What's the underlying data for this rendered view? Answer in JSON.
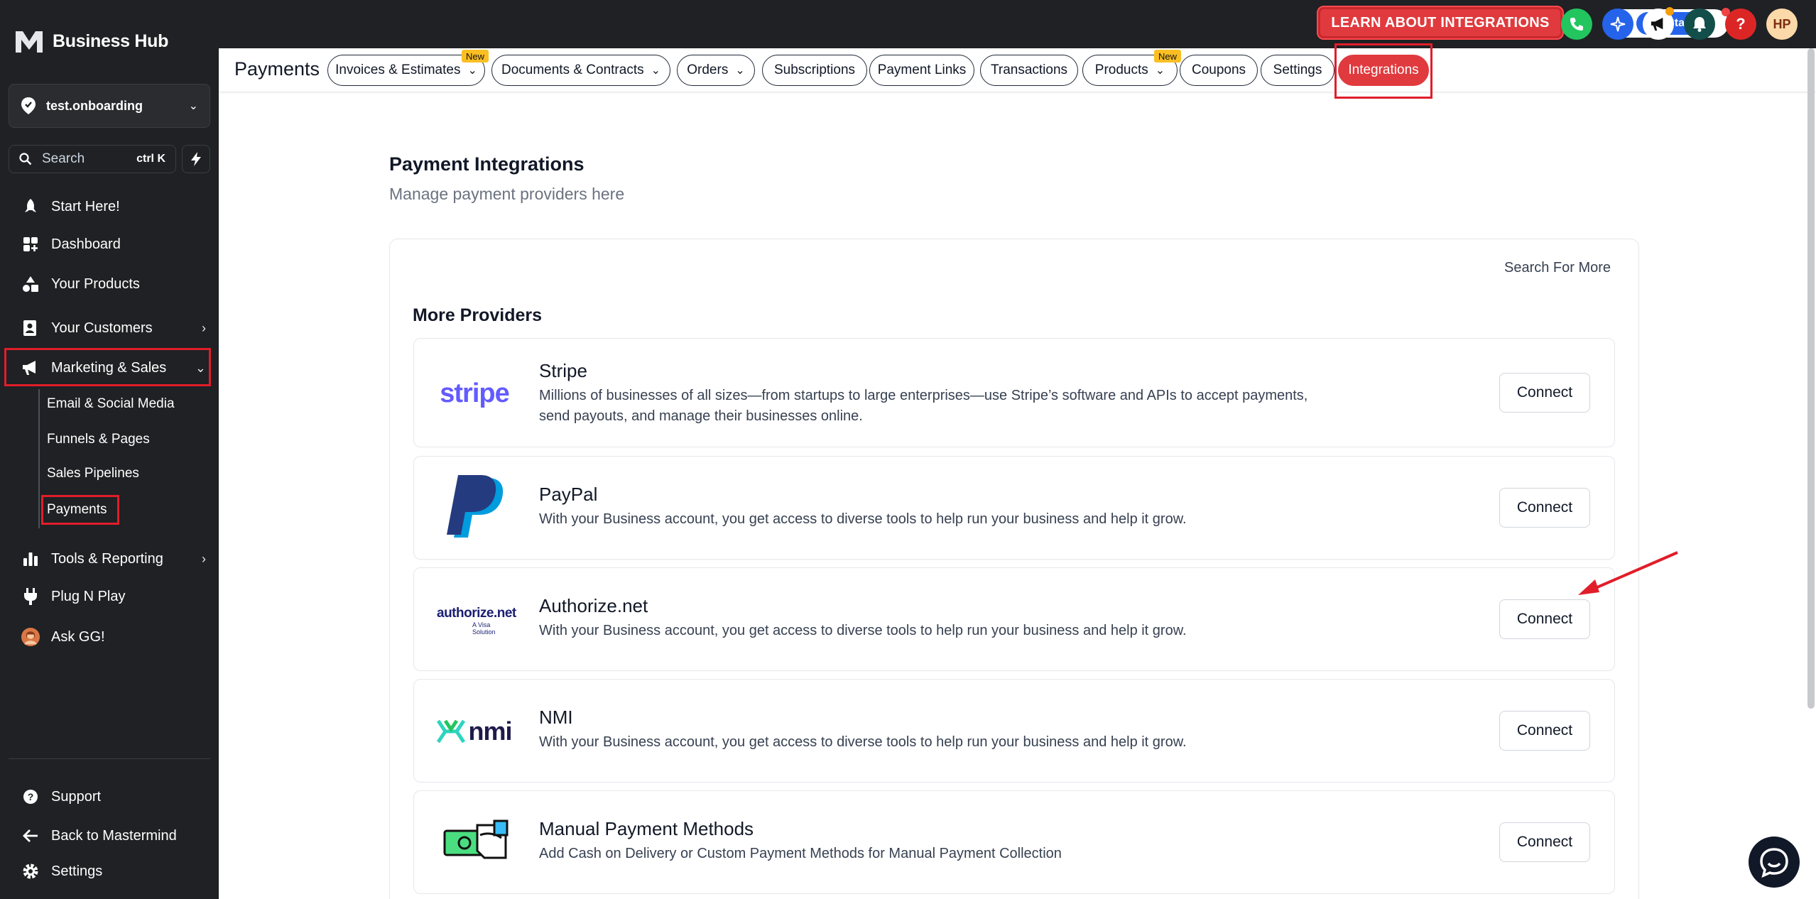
{
  "app": {
    "title": "Business Hub"
  },
  "sidebar": {
    "account": "test.onboarding",
    "search": {
      "placeholder": "Search",
      "shortcut": "ctrl K"
    },
    "items": [
      {
        "label": "Start Here!",
        "icon": "rocket-icon"
      },
      {
        "label": "Dashboard",
        "icon": "dashboard-icon"
      },
      {
        "label": "Your Products",
        "icon": "shapes-icon"
      },
      {
        "label": "Your Customers",
        "icon": "contact-card-icon"
      },
      {
        "label": "Marketing & Sales",
        "icon": "megaphone-icon"
      },
      {
        "label": "Tools & Reporting",
        "icon": "bar-chart-icon"
      },
      {
        "label": "Plug N Play",
        "icon": "plug-icon"
      },
      {
        "label": "Ask GG!",
        "icon": "avatar-icon"
      }
    ],
    "sub_items": [
      "Email & Social Media",
      "Funnels & Pages",
      "Sales Pipelines",
      "Payments"
    ],
    "footer": [
      "Support",
      "Back to Mastermind",
      "Settings"
    ]
  },
  "topbar": {
    "learn_label": "LEARN ABOUT INTEGRATIONS",
    "get_started_label": "Get Started",
    "user_initials": "HP"
  },
  "tabs": {
    "title": "Payments",
    "items": [
      {
        "label": "Invoices & Estimates",
        "badge": "New"
      },
      {
        "label": "Documents & Contracts"
      },
      {
        "label": "Orders"
      },
      {
        "label": "Subscriptions"
      },
      {
        "label": "Payment Links"
      },
      {
        "label": "Transactions"
      },
      {
        "label": "Products",
        "badge": "New"
      },
      {
        "label": "Coupons"
      },
      {
        "label": "Settings"
      },
      {
        "label": "Integrations"
      }
    ]
  },
  "main": {
    "heading": "Payment Integrations",
    "subheading": "Manage payment providers here",
    "search_more": "Search For More",
    "section_title": "More Providers",
    "providers": [
      {
        "name": "Stripe",
        "logo_text": "stripe",
        "description": "Millions of businesses of all sizes—from startups to large enterprises—use Stripe’s software and APIs to accept payments, send payouts, and manage their businesses online.",
        "action": "Connect"
      },
      {
        "name": "PayPal",
        "description": "With your Business account, you get access to diverse tools to help run your business and help it grow.",
        "action": "Connect"
      },
      {
        "name": "Authorize.net",
        "logo_text": "authorize.net",
        "logo_subtext": "A Visa Solution",
        "description": "With your Business account, you get access to diverse tools to help run your business and help it grow.",
        "action": "Connect"
      },
      {
        "name": "NMI",
        "logo_text": "nmi",
        "description": "With your Business account, you get access to diverse tools to help run your business and help it grow.",
        "action": "Connect"
      },
      {
        "name": "Manual Payment Methods",
        "description": "Add Cash on Delivery or Custom Payment Methods for Manual Payment Collection",
        "action": "Connect"
      }
    ]
  },
  "colors": {
    "accent": "#e03a3e",
    "sidebar": "#1f2124",
    "annotation": "#e11d2a"
  }
}
